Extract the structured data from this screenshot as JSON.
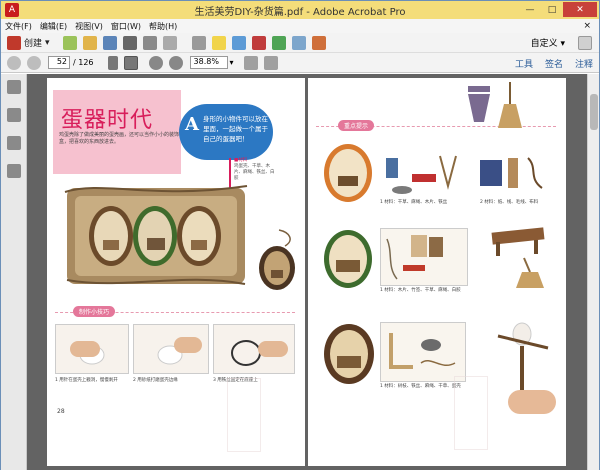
{
  "window": {
    "title": "生活美劳DIY-杂货篇.pdf - Adobe Acrobat Pro",
    "app_icon": "acrobat-icon",
    "buttons": {
      "minimize": "—",
      "maximize": "□",
      "close": "✕"
    }
  },
  "menu": {
    "items": [
      "文件(F)",
      "编辑(E)",
      "视图(V)",
      "窗口(W)",
      "帮助(H)"
    ],
    "close_doc": "×"
  },
  "toolbar1": {
    "create_label": "创建",
    "customize_label": "自定义",
    "icons": [
      "create-icon",
      "open-icon",
      "save-icon",
      "print-icon",
      "edit-icon",
      "email-icon",
      "settings-icon",
      "comment-icon",
      "stamp-icon",
      "sign-icon",
      "upload-icon",
      "form-icon",
      "expand-icon"
    ]
  },
  "toolbar2": {
    "current_page": "52",
    "total_pages": "/ 126",
    "zoom": "38.8%",
    "links": [
      "工具",
      "签名",
      "注释"
    ]
  },
  "left_page": {
    "title": "蛋器时代",
    "intro": "鸡蛋壳除了做成美丽的蛋壳画，还可以当作小小的装饰盒，把喜欢的东西放进去。",
    "bubble_letter": "A",
    "bubble_text": "身形的小物件可以放在里面，一起做一个属于自己的蛋器吧！",
    "materials_title": "■材料",
    "materials_text": "鸡蛋壳、干草、木片、麻绳、铁丝、白胶",
    "section_label": "制作小技巧",
    "steps": [
      "1 用针在蛋壳上戳洞，慢慢剥开",
      "2 用砂纸打磨蛋壳边缘",
      "3 用铁丝固定在底座上"
    ],
    "page_number": "28"
  },
  "right_page": {
    "section_label": "重点提示",
    "captions": [
      "1 材料：干草、麻绳、木片、铁丝",
      "2 材料：纸、线、毛线、布料",
      "1 材料：木片、竹签、干草、麻绳、白胶",
      "1 材料：树枝、铁丝、麻绳、干草、蛋壳"
    ]
  }
}
